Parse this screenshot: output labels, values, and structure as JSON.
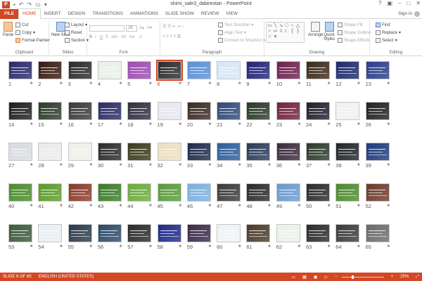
{
  "window": {
    "title": "shimi_sale3_dabirestan - PowerPoint",
    "app_icon_text": "P",
    "sign_in": "Sign in"
  },
  "tabs": [
    {
      "label": "FILE"
    },
    {
      "label": "HOME"
    },
    {
      "label": "INSERT"
    },
    {
      "label": "DESIGN"
    },
    {
      "label": "TRANSITIONS"
    },
    {
      "label": "ANIMATIONS"
    },
    {
      "label": "SLIDE SHOW"
    },
    {
      "label": "REVIEW"
    },
    {
      "label": "VIEW"
    }
  ],
  "ribbon": {
    "clipboard": {
      "label": "Clipboard",
      "paste": "Paste",
      "cut": "Cut",
      "copy": "Copy",
      "format_painter": "Format Painter"
    },
    "slides": {
      "label": "Slides",
      "new_slide": "New Slide",
      "layout": "Layout",
      "reset": "Reset",
      "section": "Section"
    },
    "font": {
      "label": "Font",
      "font_name": "",
      "font_size": "28"
    },
    "paragraph": {
      "label": "Paragraph",
      "text_direction": "Text Direction",
      "align_text": "Align Text",
      "convert_smartart": "Convert to SmartArt"
    },
    "drawing": {
      "label": "Drawing",
      "arrange": "Arrange",
      "quick_styles": "Quick Styles",
      "shape_fill": "Shape Fill",
      "shape_outline": "Shape Outline",
      "shape_effects": "Shape Effects"
    },
    "editing": {
      "label": "Editing",
      "find": "Find",
      "replace": "Replace",
      "select": "Select"
    }
  },
  "slides": [
    {
      "n": "1",
      "color": "#2a2a6a"
    },
    {
      "n": "2",
      "color": "#3a1a12"
    },
    {
      "n": "3",
      "color": "#2b2b2b"
    },
    {
      "n": "4",
      "color": "#e8f0e8"
    },
    {
      "n": "5",
      "color": "#9b4db0"
    },
    {
      "n": "6",
      "color": "#2c2c2c"
    },
    {
      "n": "7",
      "color": "#5b8fd6"
    },
    {
      "n": "8",
      "color": "#d8e6f6"
    },
    {
      "n": "9",
      "color": "#23237a"
    },
    {
      "n": "10",
      "color": "#6e2050"
    },
    {
      "n": "11",
      "color": "#3a2a18"
    },
    {
      "n": "12",
      "color": "#1c2a6b"
    },
    {
      "n": "13",
      "color": "#2a3d8a"
    },
    {
      "n": "14",
      "color": "#1e1e1e"
    },
    {
      "n": "15",
      "color": "#2b3a2b"
    },
    {
      "n": "16",
      "color": "#3a3a3a"
    },
    {
      "n": "17",
      "color": "#2b2b66"
    },
    {
      "n": "18",
      "color": "#2e2e3e"
    },
    {
      "n": "19",
      "color": "#e6e6ee"
    },
    {
      "n": "20",
      "color": "#3a2a22"
    },
    {
      "n": "21",
      "color": "#2e4a78"
    },
    {
      "n": "22",
      "color": "#2a3a2a"
    },
    {
      "n": "23",
      "color": "#722238"
    },
    {
      "n": "24",
      "color": "#1e1e2e"
    },
    {
      "n": "25",
      "color": "#f0f0f0"
    },
    {
      "n": "26",
      "color": "#202020"
    },
    {
      "n": "27",
      "color": "#d8dae0"
    },
    {
      "n": "28",
      "color": "#eaeaea"
    },
    {
      "n": "29",
      "color": "#f0f0e8"
    },
    {
      "n": "30",
      "color": "#2a2a2a"
    },
    {
      "n": "31",
      "color": "#3a3a1a"
    },
    {
      "n": "32",
      "color": "#eadfc0"
    },
    {
      "n": "33",
      "color": "#1e2a4a"
    },
    {
      "n": "34",
      "color": "#2d5d9a"
    },
    {
      "n": "35",
      "color": "#2a3a5a"
    },
    {
      "n": "36",
      "color": "#3a2a3a"
    },
    {
      "n": "37",
      "color": "#2a3a2a"
    },
    {
      "n": "38",
      "color": "#202428"
    },
    {
      "n": "39",
      "color": "#1e3a7a"
    },
    {
      "n": "40",
      "color": "#4a8a2a"
    },
    {
      "n": "41",
      "color": "#5a9a2a"
    },
    {
      "n": "42",
      "color": "#8a3a2a"
    },
    {
      "n": "43",
      "color": "#3a7a2a"
    },
    {
      "n": "44",
      "color": "#6aaa3a"
    },
    {
      "n": "45",
      "color": "#5a9a3a"
    },
    {
      "n": "46",
      "color": "#7ab0e0"
    },
    {
      "n": "47",
      "color": "#3a3a3a"
    },
    {
      "n": "48",
      "color": "#2a2a2a"
    },
    {
      "n": "49",
      "color": "#6a98d0"
    },
    {
      "n": "50",
      "color": "#2a2a2a"
    },
    {
      "n": "51",
      "color": "#4a8a2a"
    },
    {
      "n": "52",
      "color": "#6a3a2a"
    },
    {
      "n": "53",
      "color": "#3a5a3a"
    },
    {
      "n": "54",
      "color": "#e8eef4"
    },
    {
      "n": "55",
      "color": "#2a3a4a"
    },
    {
      "n": "56",
      "color": "#2a4a6a"
    },
    {
      "n": "57",
      "color": "#2a2a2a"
    },
    {
      "n": "58",
      "color": "#1e2a8a"
    },
    {
      "n": "59",
      "color": "#3a2a4a"
    },
    {
      "n": "60",
      "color": "#eef2f8"
    },
    {
      "n": "61",
      "color": "#4a3a2a"
    },
    {
      "n": "62",
      "color": "#eaf0ea"
    },
    {
      "n": "63",
      "color": "#2a2a2a"
    },
    {
      "n": "64",
      "color": "#3a3a3a"
    },
    {
      "n": "65",
      "color": "#6a6a6a"
    }
  ],
  "selected_slide": "6",
  "status": {
    "slide_info": "SLIDE 6 OF 65",
    "language": "ENGLISH (UNITED STATES)",
    "zoom": "25%"
  },
  "colors": {
    "accent": "#d24726"
  }
}
